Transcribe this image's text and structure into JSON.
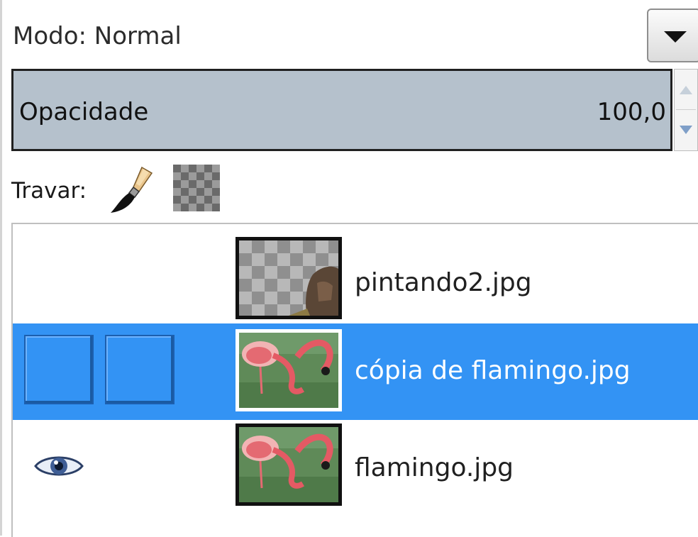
{
  "mode": {
    "label": "Modo: Normal"
  },
  "opacity": {
    "label": "Opacidade",
    "value": "100,0"
  },
  "lock": {
    "label": "Travar:"
  },
  "layers": [
    {
      "name": "pintando2.jpg",
      "visible": false,
      "selected": false
    },
    {
      "name": "cópia de flamingo.jpg",
      "visible": false,
      "selected": true
    },
    {
      "name": "flamingo.jpg",
      "visible": true,
      "selected": false
    }
  ],
  "colors": {
    "selection": "#3393f4",
    "opacity_bar": "#b5c1cc"
  }
}
